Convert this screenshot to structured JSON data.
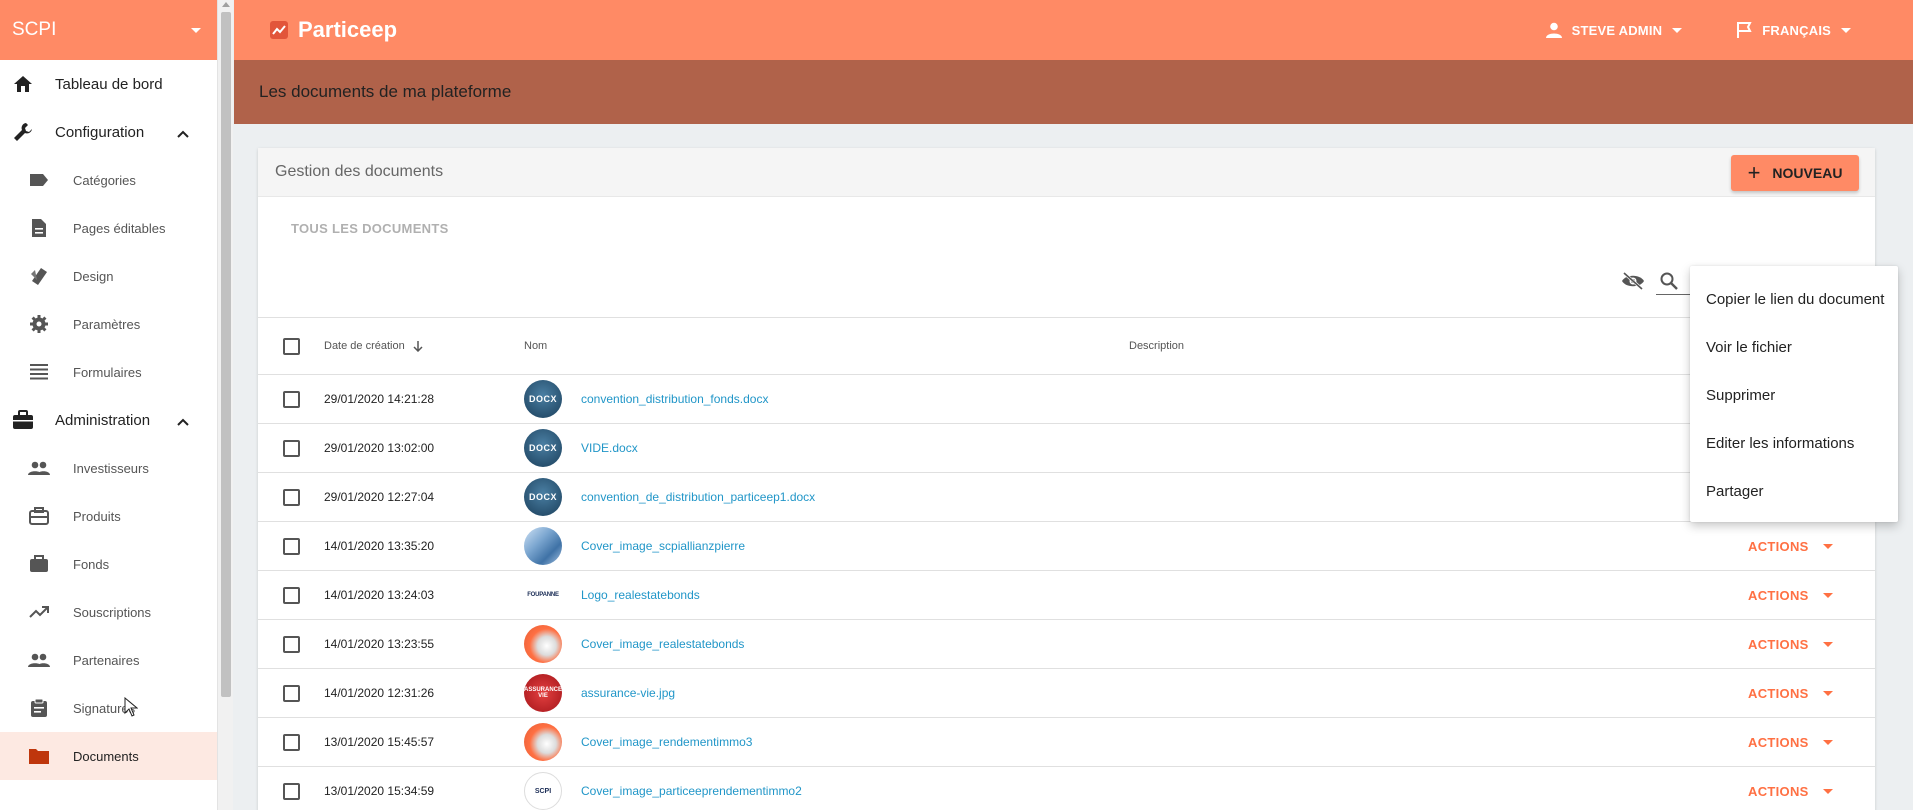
{
  "app": {
    "brand": "Particeep",
    "site_selector": "SCPI"
  },
  "header": {
    "user_label": "STEVE ADMIN",
    "language_label": "FRANÇAIS"
  },
  "page": {
    "banner_title": "Les documents de ma plateforme"
  },
  "sidebar": {
    "items": [
      {
        "label": "Tableau de bord",
        "icon": "home-icon",
        "level": "main"
      },
      {
        "label": "Configuration",
        "icon": "wrench-icon",
        "level": "main",
        "expanded": true
      },
      {
        "label": "Catégories",
        "icon": "label-icon",
        "level": "sub"
      },
      {
        "label": "Pages éditables",
        "icon": "document-icon",
        "level": "sub"
      },
      {
        "label": "Design",
        "icon": "palette-icon",
        "level": "sub"
      },
      {
        "label": "Paramètres",
        "icon": "gear-icon",
        "level": "sub"
      },
      {
        "label": "Formulaires",
        "icon": "list-icon",
        "level": "sub"
      },
      {
        "label": "Administration",
        "icon": "briefcase-icon",
        "level": "main",
        "expanded": true
      },
      {
        "label": "Investisseurs",
        "icon": "people-icon",
        "level": "sub"
      },
      {
        "label": "Produits",
        "icon": "case-icon",
        "level": "sub"
      },
      {
        "label": "Fonds",
        "icon": "briefcase-icon",
        "level": "sub"
      },
      {
        "label": "Souscriptions",
        "icon": "trending-up-icon",
        "level": "sub"
      },
      {
        "label": "Partenaires",
        "icon": "people-icon",
        "level": "sub"
      },
      {
        "label": "Signatures",
        "icon": "clipboard-icon",
        "level": "sub"
      },
      {
        "label": "Documents",
        "icon": "folder-icon",
        "level": "sub",
        "active": true
      }
    ]
  },
  "card": {
    "title": "Gestion des documents",
    "new_button_label": "NOUVEAU",
    "tab_label": "TOUS LES DOCUMENTS"
  },
  "table": {
    "columns": {
      "date": "Date de création",
      "name": "Nom",
      "description": "Description"
    },
    "rows": [
      {
        "date": "29/01/2020 14:21:28",
        "name": "convention_distribution_fonds.docx",
        "thumb": "docx",
        "thumb_text": "DOCX",
        "actions": ""
      },
      {
        "date": "29/01/2020 13:02:00",
        "name": "VIDE.docx",
        "thumb": "docx",
        "thumb_text": "DOCX",
        "actions": ""
      },
      {
        "date": "29/01/2020 12:27:04",
        "name": "convention_de_distribution_particeep1.docx",
        "thumb": "docx",
        "thumb_text": "DOCX",
        "actions": ""
      },
      {
        "date": "14/01/2020 13:35:20",
        "name": "Cover_image_scpiallianzpierre",
        "thumb": "building",
        "thumb_text": "",
        "actions": "ACTIONS"
      },
      {
        "date": "14/01/2020 13:24:03",
        "name": "Logo_realestatebonds",
        "thumb": "logo",
        "thumb_text": "FOUPANNE",
        "actions": "ACTIONS"
      },
      {
        "date": "14/01/2020 13:23:55",
        "name": "Cover_image_realestatebonds",
        "thumb": "flame",
        "thumb_text": "",
        "actions": "ACTIONS"
      },
      {
        "date": "14/01/2020 12:31:26",
        "name": "assurance-vie.jpg",
        "thumb": "assurance",
        "thumb_text": "ASSURANCE VIE",
        "actions": "ACTIONS"
      },
      {
        "date": "13/01/2020 15:45:57",
        "name": "Cover_image_rendementimmo3",
        "thumb": "flame",
        "thumb_text": "",
        "actions": "ACTIONS"
      },
      {
        "date": "13/01/2020 15:34:59",
        "name": "Cover_image_particeeprendementimmo2",
        "thumb": "scpi",
        "thumb_text": "SCPI",
        "actions": "ACTIONS"
      }
    ]
  },
  "menu": {
    "items": [
      "Copier le lien du document",
      "Voir le fichier",
      "Supprimer",
      "Editer les informations",
      "Partager"
    ]
  }
}
